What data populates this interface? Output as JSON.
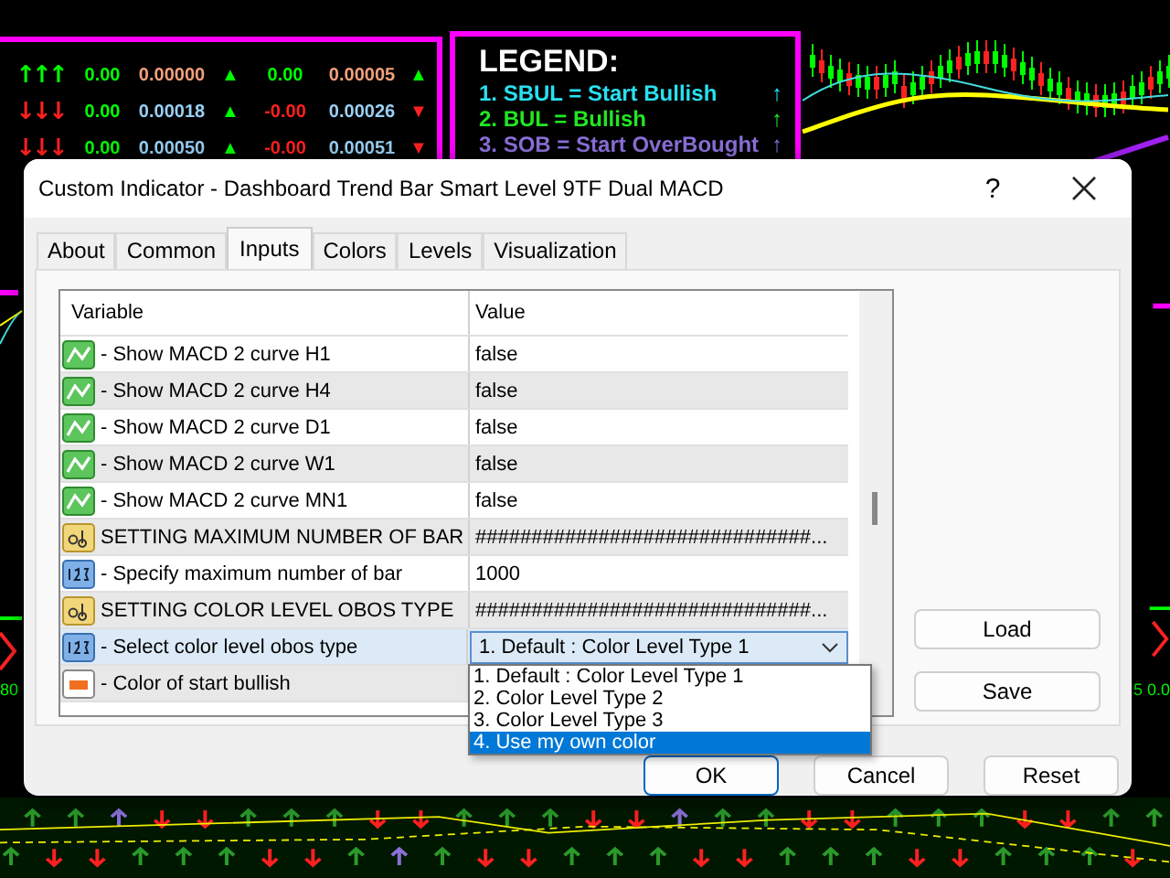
{
  "dashboard": {
    "rows": [
      [
        {
          "text": "↑↑↑",
          "color": "#00ff00"
        },
        {
          "text": "0.00",
          "color": "#00ff00"
        },
        {
          "text": "0.00000",
          "color": "#f4a07a"
        },
        {
          "text": "▲",
          "color": "#00ff00"
        },
        {
          "text": "0.00",
          "color": "#00ff00"
        },
        {
          "text": "0.00005",
          "color": "#f4a07a"
        },
        {
          "text": "▲",
          "color": "#00ff00"
        }
      ],
      [
        {
          "text": "↓↓↓",
          "color": "#ff2020"
        },
        {
          "text": "0.00",
          "color": "#00ff00"
        },
        {
          "text": "0.00018",
          "color": "#9ad0f5"
        },
        {
          "text": "▲",
          "color": "#00ff00"
        },
        {
          "text": "-0.00",
          "color": "#ff2020"
        },
        {
          "text": "0.00026",
          "color": "#9ad0f5"
        },
        {
          "text": "▼",
          "color": "#ff2020"
        }
      ],
      [
        {
          "text": "↓↓↓",
          "color": "#ff2020"
        },
        {
          "text": "0.00",
          "color": "#00ff00"
        },
        {
          "text": "0.00050",
          "color": "#9ad0f5"
        },
        {
          "text": "▲",
          "color": "#00ff00"
        },
        {
          "text": "-0.00",
          "color": "#ff2020"
        },
        {
          "text": "0.00051",
          "color": "#9ad0f5"
        },
        {
          "text": "▼",
          "color": "#ff2020"
        }
      ]
    ]
  },
  "legend": {
    "title": "LEGEND:",
    "items": [
      {
        "text": "1. SBUL = Start Bullish",
        "arrow": "↑",
        "color": "#29e0f0"
      },
      {
        "text": "2. BUL = Bullish",
        "arrow": "↑",
        "color": "#22e622"
      },
      {
        "text": "3. SOB = Start OverBought",
        "arrow": "↑",
        "color": "#8a70d8"
      }
    ]
  },
  "chart_left_label": "80",
  "chart_right_label": "5 0.0",
  "dialog": {
    "title": "Custom Indicator - Dashboard Trend Bar Smart Level 9TF Dual MACD",
    "help": "?",
    "tabs": [
      {
        "label": "About",
        "selected": false
      },
      {
        "label": "Common",
        "selected": false
      },
      {
        "label": "Inputs",
        "selected": true
      },
      {
        "label": "Colors",
        "selected": false
      },
      {
        "label": "Levels",
        "selected": false
      },
      {
        "label": "Visualization",
        "selected": false
      }
    ],
    "table": {
      "columns": [
        "Variable",
        "Value"
      ],
      "rows": [
        {
          "kind": "bool",
          "variable": "- Show MACD 2 curve H1",
          "value": "false",
          "selected": false
        },
        {
          "kind": "bool",
          "variable": "- Show MACD 2 curve H4",
          "value": "false",
          "selected": false
        },
        {
          "kind": "bool",
          "variable": "- Show MACD 2 curve D1",
          "value": "false",
          "selected": false
        },
        {
          "kind": "bool",
          "variable": "- Show MACD 2 curve W1",
          "value": "false",
          "selected": false
        },
        {
          "kind": "bool",
          "variable": "- Show MACD 2 curve MN1",
          "value": "false",
          "selected": false
        },
        {
          "kind": "string",
          "variable": "SETTING MAXIMUM NUMBER OF BAR",
          "value": "##############################...",
          "selected": false
        },
        {
          "kind": "int",
          "variable": "- Specify maximum number of bar",
          "value": "1000",
          "selected": false
        },
        {
          "kind": "string",
          "variable": "SETTING COLOR LEVEL OBOS TYPE",
          "value": "##############################...",
          "selected": false
        },
        {
          "kind": "int",
          "variable": "- Select color level obos type",
          "value": "1. Default : Color Level Type 1",
          "selected": true,
          "dropdown": {
            "expanded": true,
            "options": [
              {
                "label": "1. Default : Color Level Type 1",
                "selected": false
              },
              {
                "label": "2. Color Level Type 2",
                "selected": false
              },
              {
                "label": "3. Color Level Type 3",
                "selected": false
              },
              {
                "label": "4. Use my own color",
                "selected": true
              }
            ]
          }
        },
        {
          "kind": "color",
          "variable": "- Color of start bullish",
          "selected": false
        }
      ]
    },
    "side_buttons": [
      "Load",
      "Save"
    ],
    "buttons": [
      {
        "label": "OK",
        "default": true
      },
      {
        "label": "Cancel",
        "default": false
      },
      {
        "label": "Reset",
        "default": false
      }
    ]
  }
}
